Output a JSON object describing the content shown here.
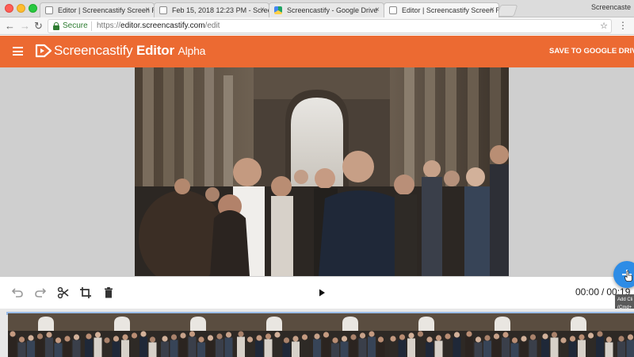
{
  "browser": {
    "tabs": [
      {
        "title": "Editor | Screencastify Screen R",
        "favicon": "page-icon",
        "active": false
      },
      {
        "title": "Feb 15, 2018 12:23 PM - Screen",
        "favicon": "page-icon",
        "active": false
      },
      {
        "title": "Screencastify - Google Drive",
        "favicon": "google-drive-icon",
        "active": false
      },
      {
        "title": "Editor | Screencastify Screen R",
        "favicon": "page-icon",
        "active": true
      }
    ],
    "profile_label": "Screencaste",
    "close_glyph": "×",
    "back_glyph": "←",
    "forward_glyph": "→",
    "reload_glyph": "↻",
    "secure_label": "Secure",
    "url_scheme": "https://",
    "url_host": "editor.screencastify.com",
    "url_path": "/edit",
    "star_glyph": "☆",
    "menu_glyph": "⋮"
  },
  "app": {
    "brand_name_light": "Screencastify",
    "brand_name_bold": "Editor",
    "brand_stage": "Alpha",
    "save_label": "SAVE TO GOOGLE DRIVE",
    "header_color": "#ec6a32"
  },
  "player": {
    "current_time": "00:00",
    "separator": "/",
    "total_time": "00:19",
    "add_tooltip_line1": "Add Cli",
    "add_tooltip_line2": "(Cmd+"
  },
  "icons": {
    "undo": "undo-icon",
    "redo": "redo-icon",
    "cut": "scissors-icon",
    "crop": "crop-icon",
    "delete": "trash-icon",
    "play": "play-icon",
    "add": "plus-icon"
  },
  "colors": {
    "accent_orange": "#ec6a32",
    "fab_blue": "#2d8ce6",
    "secure_green": "#2e7d32"
  }
}
